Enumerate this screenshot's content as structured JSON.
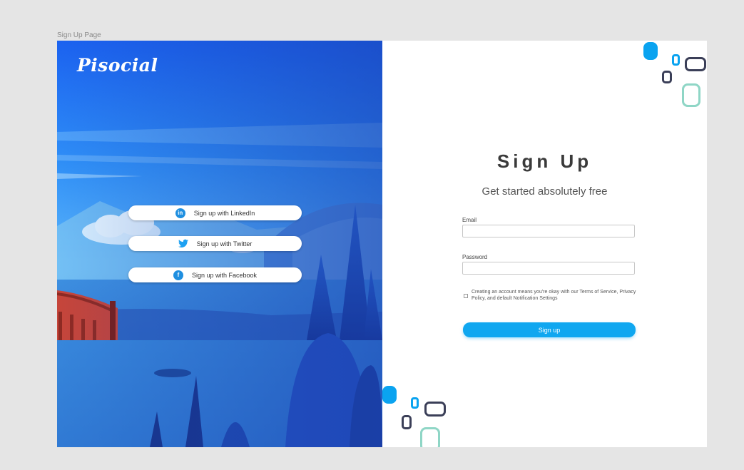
{
  "frame_label": "Sign Up Page",
  "brand": {
    "logo_text": "Pisocial"
  },
  "social": [
    {
      "label": "Sign up with LinkedIn",
      "icon": "linkedin-icon",
      "glyph": "in"
    },
    {
      "label": "Sign up with Twitter",
      "icon": "twitter-icon",
      "glyph": "🐦"
    },
    {
      "label": "Sign up with Facebook",
      "icon": "facebook-icon",
      "glyph": "f"
    }
  ],
  "form": {
    "title": "Sign Up",
    "subtitle": "Get started absolutely free",
    "email_label": "Email",
    "email_value": "",
    "password_label": "Password",
    "password_value": "",
    "terms_text": "Creating an account means you're okay with our Terms of Service, Privacy Policy, and default Notification Settings",
    "terms_checked": false,
    "submit_label": "Sign up"
  },
  "colors": {
    "accent": "#10a7f0",
    "shape_blue": "#0aa3f0",
    "shape_navy": "#3b3f58",
    "shape_mint": "#8fd6c6"
  }
}
